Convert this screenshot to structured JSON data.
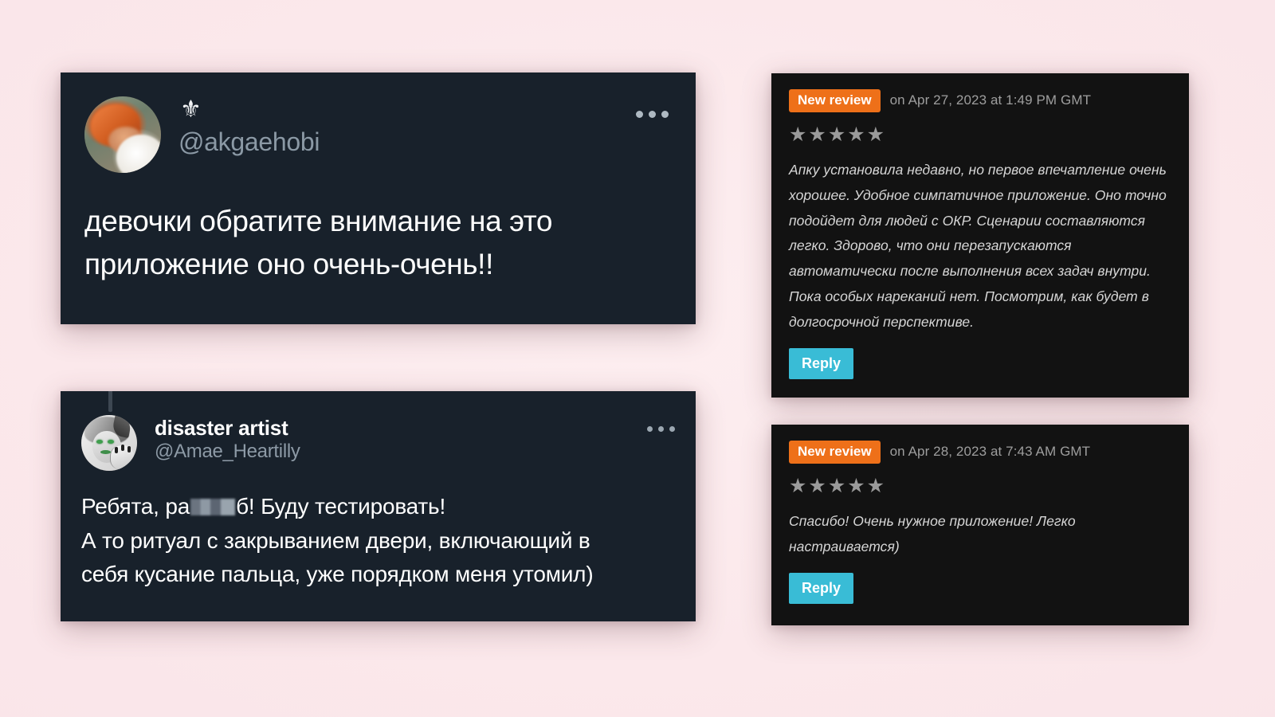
{
  "background_color": "#fbe9ec",
  "tweets": [
    {
      "card_id": "tweet-card-1",
      "card_bg": "#18212b",
      "badge_icon": "fleur-de-lis-icon",
      "badge_glyph": "⚜",
      "display_name": "",
      "handle": "@akgaehobi",
      "more_icon": "more-options-icon",
      "avatar_alt": "portrait painting avatar",
      "has_thread_line": false,
      "body_lines": [
        "девочки обратите внимание на это",
        "приложение оно очень-очень!!"
      ]
    },
    {
      "card_id": "tweet-card-2",
      "card_bg": "#18212b",
      "display_name": "disaster artist",
      "handle": "@Amae_Heartilly",
      "more_icon": "more-options-icon",
      "avatar_alt": "grayscale elf sketch avatar",
      "has_thread_line": true,
      "body_line_1_before": "Ребята, ра",
      "body_line_1_censored": "[censored]",
      "body_line_1_after": "б! Буду тестировать!",
      "body_lines_rest": [
        "А то ритуал с закрыванием двери, включающий в",
        "себя кусание пальца, уже порядком меня утомил)"
      ]
    }
  ],
  "reviews": [
    {
      "card_id": "review-card-1",
      "card_bg": "#121212",
      "badge_label": "New review",
      "badge_color": "#ee7019",
      "date": "on Apr 27, 2023 at 1:49 PM GMT",
      "rating": 5,
      "rating_stars": "★★★★★",
      "star_color": "#9a9a9a",
      "text": "Апку установила недавно, но первое впечатление очень хорошее. Удобное симпатичное приложение. Оно точно подойдет для людей с ОКР. Сценарии составляются легко. Здорово, что они перезапускаются автоматически после выполнения всех задач внутри. Пока особых нареканий нет. Посмотрим, как будет в долгосрочной перспективе.",
      "reply_label": "Reply",
      "reply_color": "#39bcd6"
    },
    {
      "card_id": "review-card-2",
      "card_bg": "#121212",
      "badge_label": "New review",
      "badge_color": "#ee7019",
      "date": "on Apr 28, 2023 at 7:43 AM GMT",
      "rating": 5,
      "rating_stars": "★★★★★",
      "star_color": "#9a9a9a",
      "text": "Спасибо! Очень нужное приложение! Легко настраивается)",
      "reply_label": "Reply",
      "reply_color": "#39bcd6"
    }
  ]
}
